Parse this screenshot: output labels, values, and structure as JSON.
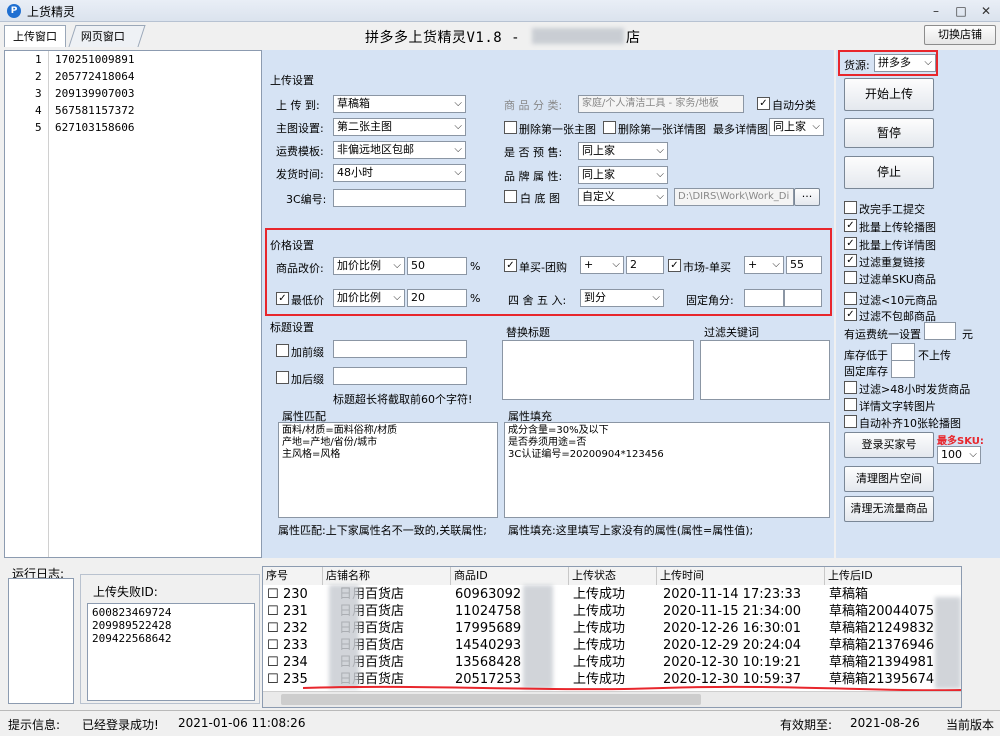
{
  "window": {
    "title": "上货精灵",
    "app_title": "拼多多上货精灵V1.8 -",
    "app_title_suffix": "店",
    "switch_shop": "切换店铺"
  },
  "tabs": [
    {
      "label": "上传窗口"
    },
    {
      "label": "网页窗口"
    }
  ],
  "id_list": [
    {
      "n": "1",
      "v": "170251009891"
    },
    {
      "n": "2",
      "v": "205772418064"
    },
    {
      "n": "3",
      "v": "209139907003"
    },
    {
      "n": "4",
      "v": "567581157372"
    },
    {
      "n": "5",
      "v": "627103158606"
    }
  ],
  "upload_settings": {
    "title": "上传设置",
    "upload_to_label": "上 传 到:",
    "upload_to_value": "草稿箱",
    "main_img_label": "主图设置:",
    "main_img_value": "第二张主图",
    "shipping_label": "运费模板:",
    "shipping_value": "非偏远地区包邮",
    "ship_time_label": "发货时间:",
    "ship_time_value": "48小时",
    "cc_label": "3C编号:",
    "cc_value": "",
    "category_label": "商 品 分 类:",
    "category_value": "家庭/个人清洁工具 - 家务/地板",
    "auto_category": "自动分类",
    "del_first_main": "删除第一张主图",
    "del_first_detail": "删除第一张详情图",
    "max_detail_label": "最多详情图",
    "max_detail_value": "同上家",
    "presale_label": "是 否 预 售:",
    "presale_value": "同上家",
    "brand_label": "品 牌 属 性:",
    "brand_value": "同上家",
    "white_bg_label": "白 底 图",
    "white_bg_value": "自定义",
    "path_value": "D:\\DIRS\\Work\\Work_Di",
    "browse": "···"
  },
  "price_settings": {
    "title": "价格设置",
    "change_label": "商品改价:",
    "change_mode": "加价比例",
    "change_value": "50",
    "percent": "%",
    "single_group": "单买-团购",
    "single_group_op": "+",
    "single_group_value": "2",
    "market_single": "市场-单买",
    "market_single_op": "+",
    "market_single_value": "55",
    "min_price": "最低价",
    "min_mode": "加价比例",
    "min_value": "20",
    "round_label": "四 舍 五 入:",
    "round_value": "到分",
    "fixed_jiao_label": "固定角分:"
  },
  "title_settings": {
    "title": "标题设置",
    "prefix": "加前缀",
    "suffix": "加后缀",
    "note": "标题超长将截取前60个字符!",
    "replace_title": "替换标题",
    "filter_keywords": "过滤关键词"
  },
  "attr_match": {
    "title": "属性匹配",
    "content": "面料/材质=面料俗称/材质\n产地=产地/省份/城市\n主风格=风格",
    "hint": "属性匹配:上下家属性名不一致的,关联属性;"
  },
  "attr_fill": {
    "title": "属性填充",
    "content": "成分含量=30%及以下\n是否券须用途=否\n3C认证编号=20200904*123456",
    "hint": "属性填充:这里填写上家没有的属性(属性=属性值);"
  },
  "right_panel": {
    "source_label": "货源:",
    "source_value": "拼多多",
    "start_upload": "开始上传",
    "pause": "暂停",
    "stop": "停止",
    "options": [
      {
        "label": "改完手工提交",
        "checked": false
      },
      {
        "label": "批量上传轮播图",
        "checked": true
      },
      {
        "label": "批量上传详情图",
        "checked": true
      },
      {
        "label": "过滤重复链接",
        "checked": true
      },
      {
        "label": "过滤单SKU商品",
        "checked": false
      },
      {
        "label": "过滤<10元商品",
        "checked": false
      },
      {
        "label": "过滤不包邮商品",
        "checked": true
      }
    ],
    "shipping_unify": "有运费统一设置",
    "yuan": "元",
    "stock_below": "库存低于",
    "no_upload": "不上传",
    "fixed_stock": "固定库存",
    "options2": [
      {
        "label": "过滤>48小时发货商品",
        "checked": false
      },
      {
        "label": "详情文字转图片",
        "checked": false
      },
      {
        "label": "自动补齐10张轮播图",
        "checked": false
      }
    ],
    "login_buyer": "登录买家号",
    "max_sku_label": "最多SKU:",
    "max_sku_value": "100",
    "clean_images": "清理图片空间",
    "clean_no_traffic": "清理无流量商品"
  },
  "bottom": {
    "run_log": "运行日志:",
    "fail_ids_label": "上传失败ID:",
    "fail_ids": [
      "600823469724",
      "209989522428",
      "209422568642"
    ],
    "columns": [
      "序号",
      "店铺名称",
      "商品ID",
      "上传状态",
      "上传时间",
      "上传后ID"
    ],
    "rows": [
      {
        "seq": "230",
        "shop": "日用百货店",
        "pid": "60963092",
        "status": "上传成功",
        "time": "2020-11-14  17:23:33",
        "after": "草稿箱"
      },
      {
        "seq": "231",
        "shop": "日用百货店",
        "pid": "11024758",
        "status": "上传成功",
        "time": "2020-11-15  21:34:00",
        "after": "草稿箱20044075"
      },
      {
        "seq": "232",
        "shop": "日用百货店",
        "pid": "17995689",
        "status": "上传成功",
        "time": "2020-12-26  16:30:01",
        "after": "草稿箱21249832"
      },
      {
        "seq": "233",
        "shop": "日用百货店",
        "pid": "14540293",
        "status": "上传成功",
        "time": "2020-12-29  20:24:04",
        "after": "草稿箱21376946"
      },
      {
        "seq": "234",
        "shop": "日用百货店",
        "pid": "13568428",
        "status": "上传成功",
        "time": "2020-12-30  10:19:21",
        "after": "草稿箱21394981"
      },
      {
        "seq": "235",
        "shop": "日用百货店",
        "pid": "20517253",
        "status": "上传成功",
        "time": "2020-12-30  10:59:37",
        "after": "草稿箱21395674"
      }
    ]
  },
  "status": {
    "hint_label": "提示信息:",
    "message": "已经登录成功!",
    "time": "2021-01-06 11:08:26",
    "valid_label": "有效期至:",
    "valid_date": "2021-08-26",
    "version_label": "当前版本"
  },
  "colors": {
    "panel": "#d6e3f4",
    "highlight": "#e8262c"
  }
}
